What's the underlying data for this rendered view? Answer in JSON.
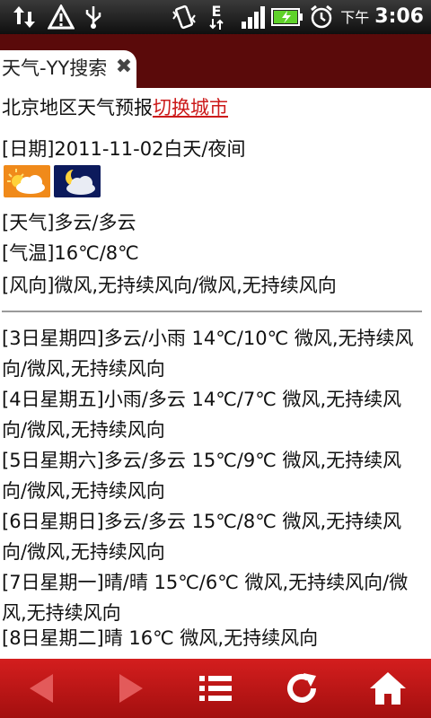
{
  "status_bar": {
    "ampm": "下午",
    "time": "3:06",
    "network_label": "E"
  },
  "tab": {
    "title": "天气-YY搜索"
  },
  "header": {
    "title": "北京地区天气预报",
    "switch_city": "切换城市"
  },
  "today": {
    "date": "[日期]2011-11-02白天/夜间",
    "weather": "[天气]多云/多云",
    "temperature": "[气温]16℃/8℃",
    "wind": "[风向]微风,无持续风向/微风,无持续风向",
    "icons": [
      "partly-cloudy-day-icon",
      "cloudy-night-icon"
    ]
  },
  "forecast": [
    {
      "text": "[3日星期四]多云/小雨 14℃/10℃ 微风,无持续风向/微风,无持续风向"
    },
    {
      "text": "[4日星期五]小雨/多云 14℃/7℃ 微风,无持续风向/微风,无持续风向"
    },
    {
      "text": "[5日星期六]多云/多云 15℃/9℃ 微风,无持续风向/微风,无持续风向"
    },
    {
      "text": "[6日星期日]多云/多云 15℃/8℃ 微风,无持续风向/微风,无持续风向"
    },
    {
      "text": "[7日星期一]晴/晴 15℃/6℃ 微风,无持续风向/微风,无持续风向"
    },
    {
      "text": "[8日星期二]晴 16℃ 微风,无持续风向"
    }
  ],
  "colors": {
    "tab_bar": "#5a0a0a",
    "bottom_bar": "#c41616",
    "link": "#cc1a1a"
  }
}
